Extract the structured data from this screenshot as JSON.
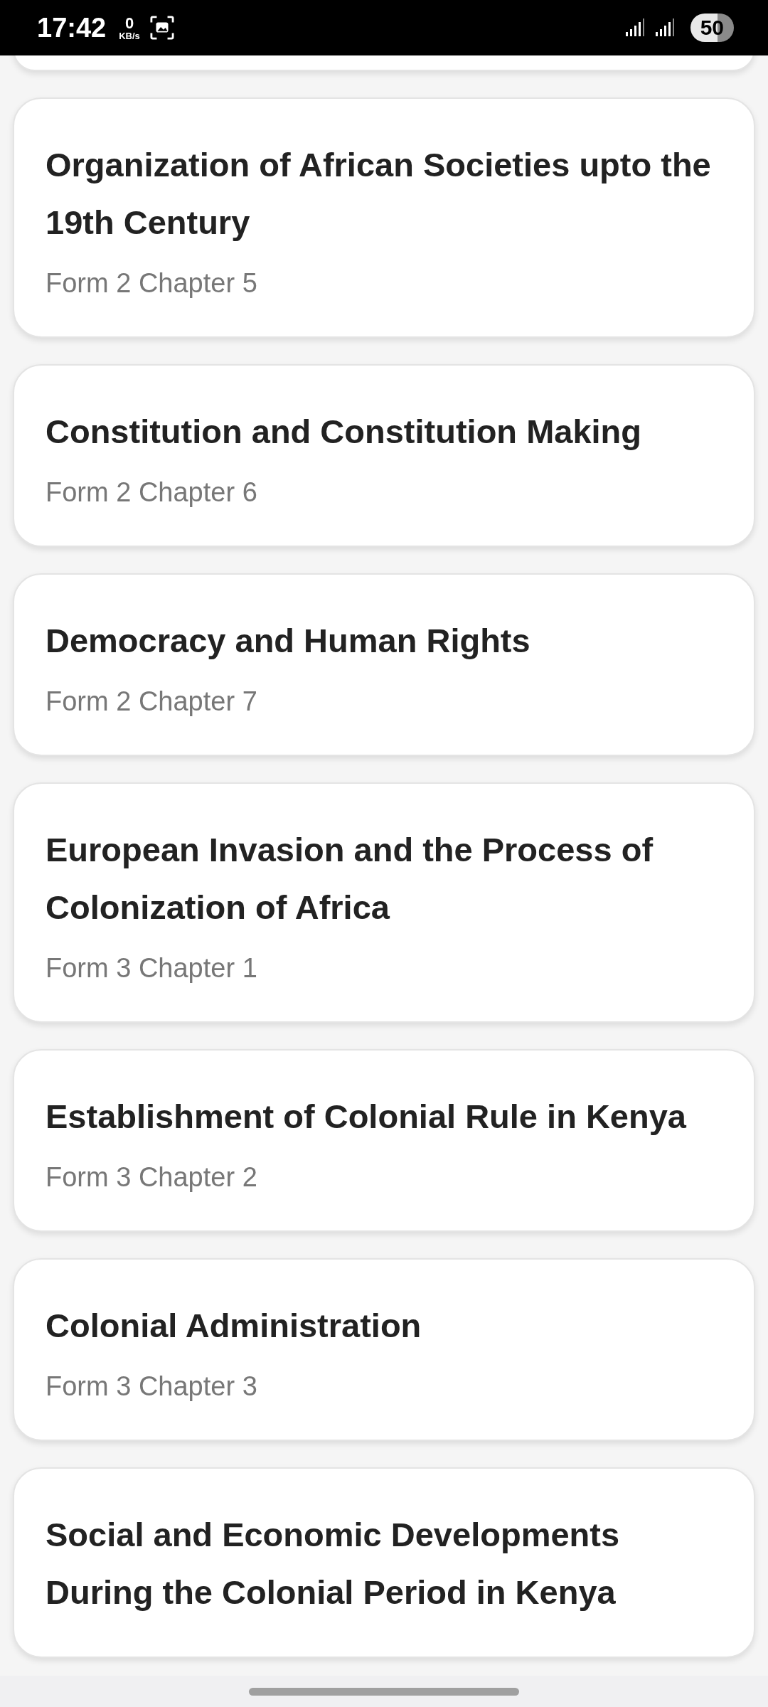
{
  "status_bar": {
    "time": "17:42",
    "speed_value": "0",
    "speed_unit": "KB/s",
    "battery": "50"
  },
  "chapters": [
    {
      "title": "Organization of African Societies upto the 19th Century",
      "subtitle": "Form 2 Chapter 5"
    },
    {
      "title": "Constitution and Constitution Making",
      "subtitle": "Form 2 Chapter 6"
    },
    {
      "title": "Democracy and Human Rights",
      "subtitle": "Form 2 Chapter 7"
    },
    {
      "title": "European Invasion and the Process of Colonization of Africa",
      "subtitle": "Form 3 Chapter 1"
    },
    {
      "title": "Establishment of Colonial Rule in Kenya",
      "subtitle": "Form 3 Chapter 2"
    },
    {
      "title": "Colonial Administration",
      "subtitle": "Form 3 Chapter 3"
    },
    {
      "title": "Social and Economic Developments During the Colonial Period in Kenya"
    }
  ]
}
